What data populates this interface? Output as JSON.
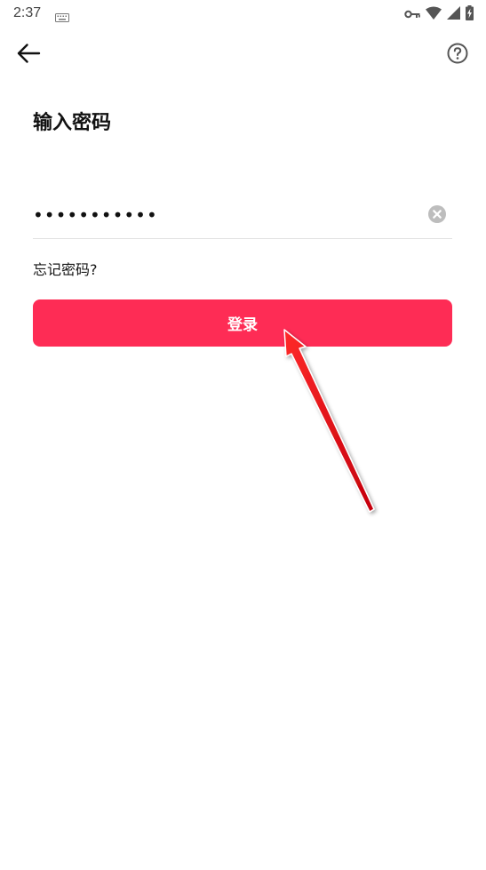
{
  "status_bar": {
    "time": "2:37",
    "icons": [
      "keyboard-icon",
      "vpn-key-icon",
      "wifi-icon",
      "signal-icon",
      "battery-charging-icon"
    ]
  },
  "app_bar": {
    "back_icon": "arrow-left-icon",
    "help_icon": "question-circle-icon"
  },
  "page": {
    "title": "输入密码",
    "password_value": "•••••••••••",
    "clear_icon": "clear-circle-icon",
    "forgot_label": "忘记密码?",
    "login_label": "登录"
  },
  "colors": {
    "accent": "#fe2c55",
    "annotation_arrow": "#e8101a"
  }
}
